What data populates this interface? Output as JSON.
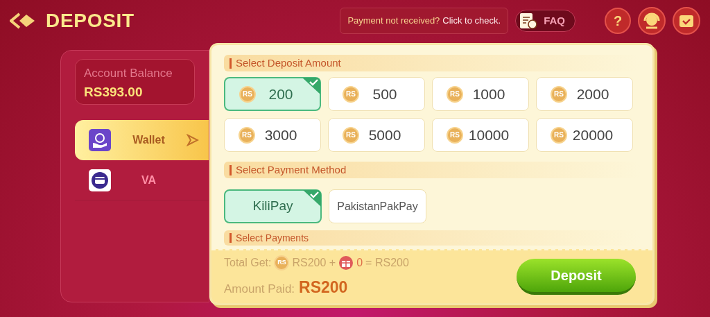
{
  "header": {
    "title": "DEPOSIT",
    "notice": "Payment not received?",
    "notice_link": "Click to check.",
    "faq": "FAQ",
    "help": "?"
  },
  "balance": {
    "label": "Account Balance",
    "value": "RS393.00"
  },
  "channels": [
    {
      "label": "Wallet",
      "kind": "wallet",
      "selected": true
    },
    {
      "label": "VA",
      "kind": "card",
      "selected": false
    }
  ],
  "amount_section": {
    "title": "Select Deposit Amount",
    "options": [
      {
        "coin": "RS",
        "value": "200",
        "selected": true
      },
      {
        "coin": "RS",
        "value": "500",
        "selected": false
      },
      {
        "coin": "RS",
        "value": "1000",
        "selected": false
      },
      {
        "coin": "RS",
        "value": "2000",
        "selected": false
      },
      {
        "coin": "RS",
        "value": "3000",
        "selected": false
      },
      {
        "coin": "RS",
        "value": "5000",
        "selected": false
      },
      {
        "coin": "RS",
        "value": "10000",
        "selected": false
      },
      {
        "coin": "RS",
        "value": "20000",
        "selected": false
      }
    ]
  },
  "method_section": {
    "title": "Select Payment Method",
    "options": [
      {
        "label": "KiliPay",
        "selected": true
      },
      {
        "label": "PakistanPakPay",
        "selected": false
      }
    ]
  },
  "payments_section": {
    "title": "Select Payments"
  },
  "footer": {
    "total_label": "Total Get:",
    "coin": "RS",
    "total_amount": "RS200 +",
    "bonus": "0",
    "result": "= RS200",
    "paid_label": "Amount Paid:",
    "paid_value": "RS200",
    "button": "Deposit"
  }
}
